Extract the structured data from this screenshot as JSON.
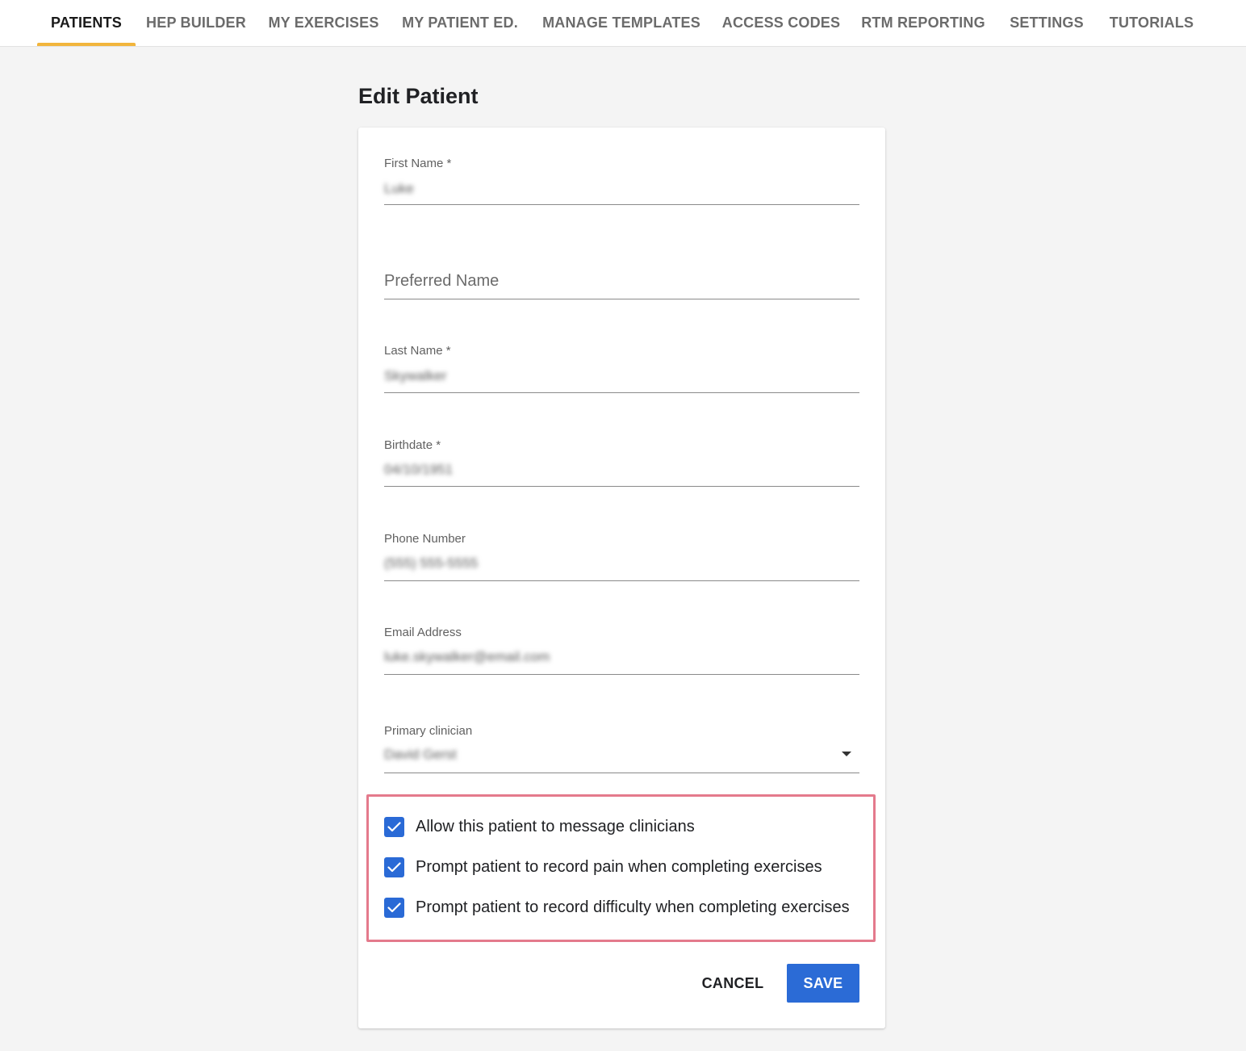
{
  "nav": {
    "tabs": [
      {
        "label": "PATIENTS",
        "active": true
      },
      {
        "label": "HEP BUILDER"
      },
      {
        "label": "MY EXERCISES"
      },
      {
        "label": "MY PATIENT ED."
      },
      {
        "label": "MANAGE TEMPLATES"
      },
      {
        "label": "ACCESS CODES"
      },
      {
        "label": "RTM REPORTING"
      },
      {
        "label": "SETTINGS"
      },
      {
        "label": "TUTORIALS"
      }
    ],
    "active_indicator_color": "#f2b53c"
  },
  "page": {
    "title": "Edit Patient"
  },
  "form": {
    "first_name": {
      "label": "First Name *",
      "value": "Luke"
    },
    "preferred_name": {
      "placeholder": "Preferred Name"
    },
    "last_name": {
      "label": "Last Name *",
      "value": "Skywalker"
    },
    "birthdate": {
      "label": "Birthdate *",
      "value": "04/10/1951"
    },
    "phone": {
      "label": "Phone Number",
      "value": "(555) 555-5555"
    },
    "email": {
      "label": "Email Address",
      "value": "luke.skywalker@email.com"
    },
    "primary_clinician": {
      "label": "Primary clinician",
      "value": "David Gerst"
    },
    "checkboxes": [
      {
        "label": "Allow this patient to message clinicians",
        "checked": true
      },
      {
        "label": "Prompt patient to record pain when completing exercises",
        "checked": true
      },
      {
        "label": "Prompt patient to record difficulty when completing exercises",
        "checked": true
      }
    ],
    "cancel_label": "CANCEL",
    "save_label": "SAVE"
  },
  "colors": {
    "accent": "#2b6bd6",
    "highlight_border": "#e47a8c",
    "background": "#f4f4f4"
  }
}
